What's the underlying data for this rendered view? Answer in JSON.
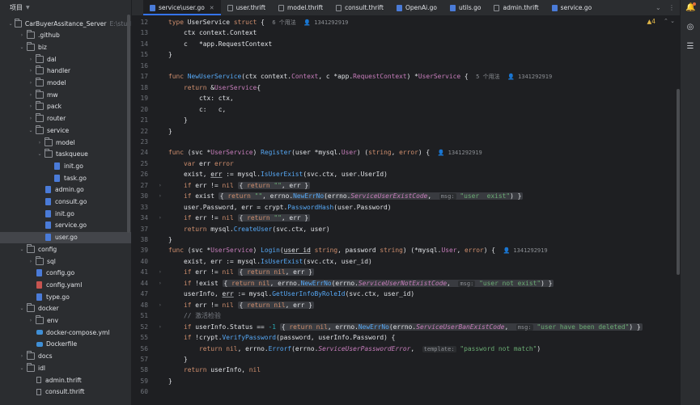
{
  "project": {
    "label": "项目",
    "root": "CarBuyerAssitance_Server",
    "root_path": "E:\\stud"
  },
  "tree": [
    {
      "name": "CarBuyerAssitance_Server",
      "kind": "folder",
      "depth": 0,
      "open": true
    },
    {
      "name": ".github",
      "kind": "folder",
      "depth": 1,
      "open": false
    },
    {
      "name": "biz",
      "kind": "folder",
      "depth": 1,
      "open": true
    },
    {
      "name": "dal",
      "kind": "folder",
      "depth": 2,
      "open": false
    },
    {
      "name": "handler",
      "kind": "folder",
      "depth": 2,
      "open": false
    },
    {
      "name": "model",
      "kind": "folder",
      "depth": 2,
      "open": false
    },
    {
      "name": "mw",
      "kind": "folder",
      "depth": 2,
      "open": false
    },
    {
      "name": "pack",
      "kind": "folder",
      "depth": 2,
      "open": false
    },
    {
      "name": "router",
      "kind": "folder",
      "depth": 2,
      "open": false
    },
    {
      "name": "service",
      "kind": "folder",
      "depth": 2,
      "open": true
    },
    {
      "name": "model",
      "kind": "folder",
      "depth": 3,
      "open": false
    },
    {
      "name": "taskqueue",
      "kind": "folder",
      "depth": 3,
      "open": true
    },
    {
      "name": "init.go",
      "kind": "go",
      "depth": 4
    },
    {
      "name": "task.go",
      "kind": "go",
      "depth": 4
    },
    {
      "name": "admin.go",
      "kind": "go",
      "depth": 3
    },
    {
      "name": "consult.go",
      "kind": "go",
      "depth": 3
    },
    {
      "name": "init.go",
      "kind": "go",
      "depth": 3
    },
    {
      "name": "service.go",
      "kind": "go",
      "depth": 3
    },
    {
      "name": "user.go",
      "kind": "go",
      "depth": 3,
      "selected": true
    },
    {
      "name": "config",
      "kind": "folder",
      "depth": 1,
      "open": true
    },
    {
      "name": "sql",
      "kind": "folder",
      "depth": 2,
      "open": false
    },
    {
      "name": "config.go",
      "kind": "go",
      "depth": 2
    },
    {
      "name": "config.yaml",
      "kind": "yaml",
      "depth": 2
    },
    {
      "name": "type.go",
      "kind": "go",
      "depth": 2
    },
    {
      "name": "docker",
      "kind": "folder",
      "depth": 1,
      "open": true
    },
    {
      "name": "env",
      "kind": "folder",
      "depth": 2,
      "open": false
    },
    {
      "name": "docker-compose.yml",
      "kind": "docker",
      "depth": 2
    },
    {
      "name": "Dockerfile",
      "kind": "docker",
      "depth": 2
    },
    {
      "name": "docs",
      "kind": "folder",
      "depth": 1,
      "open": false
    },
    {
      "name": "idl",
      "kind": "folder",
      "depth": 1,
      "open": true
    },
    {
      "name": "admin.thrift",
      "kind": "thrift",
      "depth": 2
    },
    {
      "name": "consult.thrift",
      "kind": "thrift",
      "depth": 2
    }
  ],
  "tabs": [
    {
      "label": "service\\user.go",
      "kind": "go",
      "active": true,
      "closable": true
    },
    {
      "label": "user.thrift",
      "kind": "thrift"
    },
    {
      "label": "model.thrift",
      "kind": "thrift"
    },
    {
      "label": "consult.thrift",
      "kind": "thrift"
    },
    {
      "label": "OpenAi.go",
      "kind": "go"
    },
    {
      "label": "utils.go",
      "kind": "go"
    },
    {
      "label": "admin.thrift",
      "kind": "thrift"
    },
    {
      "label": "service.go",
      "kind": "go"
    }
  ],
  "editor": {
    "warnings": "▲4"
  },
  "code_lines": [
    {
      "n": "12",
      "html": "<span class='kw'>type</span> <span class='ty'>UserService</span> <span class='kw'>struct</span> {  <span class='hint'>6 个用法</span>  <span class='hint'>👤 1341292919</span>"
    },
    {
      "n": "13",
      "html": "    ctx context.Context"
    },
    {
      "n": "14",
      "html": "    c   *app.RequestContext"
    },
    {
      "n": "15",
      "html": "}"
    },
    {
      "n": "16",
      "html": ""
    },
    {
      "n": "17",
      "html": "<span class='kw'>func</span> <span class='fn'>NewUserService</span>(ctx context.<span class='tyc'>Context</span>, c *app.<span class='tyc'>RequestContext</span>) *<span class='tyc'>UserService</span> {  <span class='hint'>5 个用法</span>  <span class='hint'>👤 1341292919</span>"
    },
    {
      "n": "18",
      "html": "    <span class='kw'>return</span> &amp;<span class='tyc'>UserService</span>{"
    },
    {
      "n": "19",
      "html": "        ctx: ctx,"
    },
    {
      "n": "20",
      "html": "        c:   c,"
    },
    {
      "n": "21",
      "html": "    }"
    },
    {
      "n": "22",
      "html": "}"
    },
    {
      "n": "23",
      "html": ""
    },
    {
      "n": "24",
      "html": "<span class='kw'>func</span> (svc *<span class='tyc'>UserService</span>) <span class='fn'>Register</span>(user *mysql.<span class='tyc'>User</span>) (<span class='kw'>string</span>, <span class='kw'>error</span>) {  <span class='hint'>👤 1341292919</span>"
    },
    {
      "n": "25",
      "html": "    <span class='kw'>var</span> err <span class='kw'>error</span>"
    },
    {
      "n": "26",
      "html": "    exist, <span class='underline'>err</span> := mysql.<span class='meth'>IsUserExist</span>(svc.ctx, user.UserId)"
    },
    {
      "n": "27",
      "html": "    <span class='kw'>if</span> err != <span class='kw'>nil</span> <span class='fold-box'>{ <span class='kw'>return</span> <span class='str'>\"\"</span>, err }</span>"
    },
    {
      "n": "30",
      "html": "    <span class='kw'>if</span> exist <span class='fold-box'>{ <span class='kw'>return</span> <span class='str'>\"\"</span>, errno.<span class='meth'>NewErrNo</span>(errno.<span class='em'>ServiceUserExistCode</span>,  <span class='hintbox'>msg:</span> <span class='str'>\"user  exist\"</span>) }</span>"
    },
    {
      "n": "33",
      "html": "    user.Password, err = crypt.<span class='meth'>PasswordHash</span>(user.Password)"
    },
    {
      "n": "34",
      "html": "    <span class='kw'>if</span> err != <span class='kw'>nil</span> <span class='fold-box'>{ <span class='kw'>return</span> <span class='str'>\"\"</span>, err }</span>"
    },
    {
      "n": "37",
      "html": "    <span class='kw'>return</span> mysql.<span class='meth'>CreateUser</span>(svc.ctx, user)"
    },
    {
      "n": "38",
      "html": "}"
    },
    {
      "n": "39",
      "html": "<span class='kw'>func</span> (svc *<span class='tyc'>UserService</span>) <span class='fn'>Login</span>(<span class='underline'>user_id</span> <span class='kw'>string</span>, password <span class='kw'>string</span>) (*mysql.<span class='tyc'>User</span>, <span class='kw'>error</span>) {  <span class='hint'>👤 1341292919</span>"
    },
    {
      "n": "40",
      "html": "    exist, err := mysql.<span class='meth'>IsUserExist</span>(svc.ctx, user_id)"
    },
    {
      "n": "41",
      "html": "    <span class='kw'>if</span> err != <span class='kw'>nil</span> <span class='fold-box'>{ <span class='kw'>return</span> <span class='kw'>nil</span>, err }</span>"
    },
    {
      "n": "44",
      "html": "    <span class='kw'>if</span> !exist <span class='fold-box'>{ <span class='kw'>return</span> <span class='kw'>nil</span>, errno.<span class='meth'>NewErrNo</span>(errno.<span class='em'>ServiceUserNotExistCode</span>,  <span class='hintbox'>msg:</span> <span class='str'>\"user not exist\"</span>) }</span>"
    },
    {
      "n": "47",
      "html": "    userInfo, <span class='underline'>err</span> := mysql.<span class='meth'>GetUserInfoByRoleId</span>(svc.ctx, user_id)"
    },
    {
      "n": "48",
      "html": "    <span class='kw'>if</span> err != <span class='kw'>nil</span> <span class='fold-box'>{ <span class='kw'>return</span> <span class='kw'>nil</span>, err }</span>"
    },
    {
      "n": "51",
      "html": "    <span class='cm'>// 激活检验</span>"
    },
    {
      "n": "52",
      "html": "    <span class='kw'>if</span> userInfo.Status == <span class='num'>-1</span> <span class='fold-box'>{ <span class='kw'>return</span> <span class='kw'>nil</span>, errno.<span class='meth'>NewErrNo</span>(errno.<span class='em'>ServiceUserBanExistCode</span>,  <span class='hintbox'>msg:</span> <span class='str'>\"user have been deleted\"</span>) }</span>"
    },
    {
      "n": "55",
      "html": "    <span class='kw'>if</span> !crypt.<span class='meth'>VerifyPassword</span>(password, userInfo.Password) {"
    },
    {
      "n": "56",
      "html": "        <span class='kw'>return</span> <span class='kw'>nil</span>, errno.<span class='meth'>Errorf</span>(errno.<span class='em'>ServiceUserPasswordError</span>,  <span class='hintbox'>template:</span> <span class='str'>\"password not match\"</span>)"
    },
    {
      "n": "57",
      "html": "    }"
    },
    {
      "n": "58",
      "html": "    <span class='kw'>return</span> userInfo, <span class='kw'>nil</span>"
    },
    {
      "n": "59",
      "html": "}"
    },
    {
      "n": "60",
      "html": ""
    }
  ],
  "folds": [
    "27",
    "30",
    "34",
    "41",
    "44",
    "48",
    "52"
  ]
}
